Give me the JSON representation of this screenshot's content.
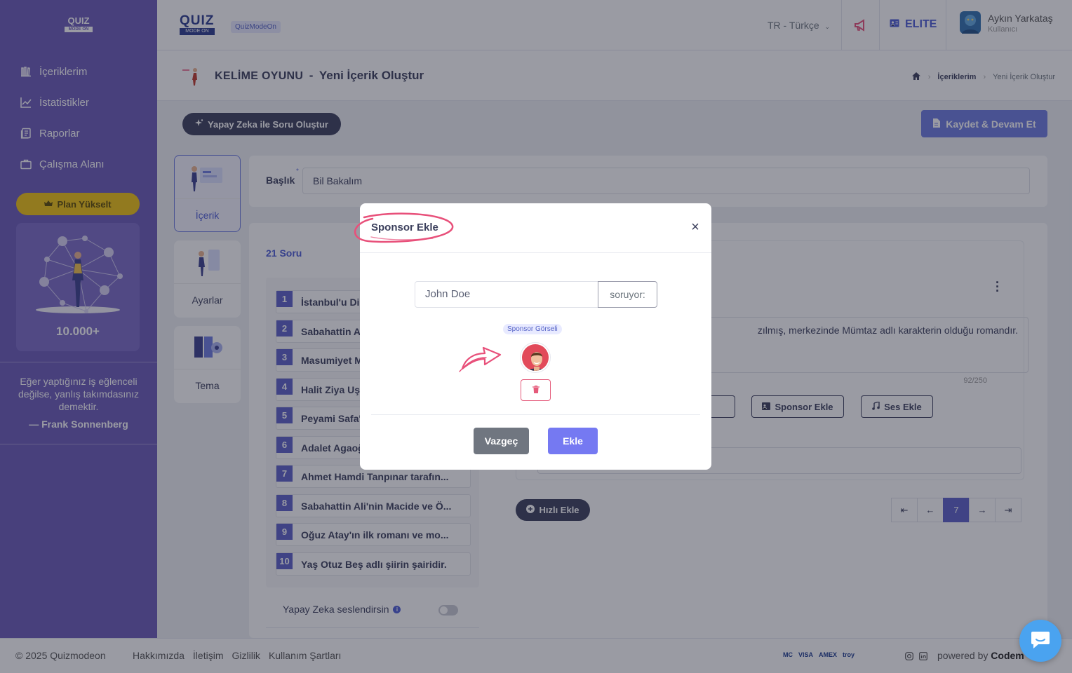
{
  "sidebar": {
    "logo": {
      "top": "QUIZ",
      "bottom": "MODE ON"
    },
    "items": [
      {
        "label": "İçeriklerim",
        "icon": "library-icon"
      },
      {
        "label": "İstatistikler",
        "icon": "chart-icon"
      },
      {
        "label": "Raporlar",
        "icon": "report-icon"
      },
      {
        "label": "Çalışma Alanı",
        "icon": "briefcase-icon"
      }
    ],
    "plan_button": "Plan Yükselt",
    "promo_count": "10.000+",
    "quote": "Eğer yaptığınız iş eğlenceli değilse, yanlış takımdasınız demektir.",
    "quote_author": "— Frank Sonnenberg"
  },
  "header": {
    "logo": {
      "top": "QUIZ",
      "bottom": "MODE ON"
    },
    "brand_pill": "QuizModeOn",
    "language": "TR - Türkçe",
    "plan": "ELITE",
    "user_name": "Aykın Yarkataş",
    "user_role": "Kullanıcı"
  },
  "subheader": {
    "game": "KELİME OYUNU",
    "dash": "-",
    "title": "Yeni İçerik Oluştur",
    "breadcrumb": [
      "İçeriklerim",
      "Yeni İçerik Oluştur"
    ]
  },
  "toolbar": {
    "ai_button": "Yapay Zeka ile Soru Oluştur",
    "save_button": "Kaydet & Devam Et"
  },
  "tabs": [
    {
      "label": "İçerik",
      "active": true
    },
    {
      "label": "Ayarlar",
      "active": false
    },
    {
      "label": "Tema",
      "active": false
    }
  ],
  "form": {
    "title_label": "Başlık",
    "title_required": "*",
    "title_value": "Bil Bakalım"
  },
  "questions": {
    "count_label": "21 Soru",
    "items": [
      {
        "num": "1",
        "text": "İstanbul'u Di"
      },
      {
        "num": "2",
        "text": "Sabahattin A"
      },
      {
        "num": "3",
        "text": "Masumiyet M"
      },
      {
        "num": "4",
        "text": "Halit Ziya Uş"
      },
      {
        "num": "5",
        "text": "Peyami Safa'"
      },
      {
        "num": "6",
        "text": "Adalet Agaoğ"
      },
      {
        "num": "7",
        "text": "Ahmet Hamdi Tanpınar tarafın..."
      },
      {
        "num": "8",
        "text": "Sabahattin Ali'nin Macide ve Ö..."
      },
      {
        "num": "9",
        "text": "Oğuz Atay'ın ilk romanı ve mo..."
      },
      {
        "num": "10",
        "text": "Yaş Otuz Beş adlı şiirin şairidir."
      }
    ],
    "ai_voice_label": "Yapay Zeka seslendirsin",
    "ai_voice_info": "i"
  },
  "editor": {
    "question_text": "zılmış, merkezinde Mümtaz adlı karakterin olduğu romandır.",
    "char_count": "92/250",
    "sponsor_button": "Sponsor Ekle",
    "sound_button": "Ses Ekle",
    "quick_add": "Hızlı Ekle",
    "pager": {
      "first": "⇤",
      "prev": "←",
      "current": "7",
      "next": "→",
      "last": "⇥"
    }
  },
  "footer": {
    "copyright": "© 2025 Quizmodeon",
    "links": [
      "Hakkımızda",
      "İletişim",
      "Gizlilik",
      "Kullanım Şartları"
    ],
    "payments": [
      "MC",
      "VISA",
      "AMEX",
      "troy"
    ],
    "powered_prefix": "powered by",
    "powered_brand": "Codem"
  },
  "modal": {
    "title": "Sponsor Ekle",
    "close": "×",
    "name_placeholder": "John Doe",
    "asks_suffix": "soruyor:",
    "image_badge": "Sponsor Görseli",
    "cancel": "Vazgeç",
    "add": "Ekle"
  },
  "colors": {
    "sidebar": "#6a59b9",
    "accent": "#6c7ae0",
    "primary_button": "#7579f2",
    "cancel_button": "#707680",
    "annotation_pink": "#e8507a",
    "chat_fab": "#4aa3f0"
  }
}
